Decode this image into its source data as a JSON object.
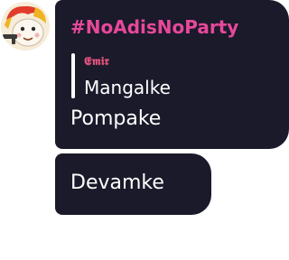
{
  "colors": {
    "bubble": "#1a1a2b",
    "sender": "#e8489a",
    "reply_author": "#e0527a",
    "reply_bar": "#ffffff",
    "text": "#ffffff"
  },
  "avatar": {
    "icon": "cartoon-avatar-icon"
  },
  "messages": [
    {
      "sender": "#NoAdisNoParty",
      "reply": {
        "author": "𝕰𝖒𝖎𝖗",
        "text": "Mangalke"
      },
      "text": "Pompake"
    },
    {
      "text": "Devamke"
    }
  ]
}
